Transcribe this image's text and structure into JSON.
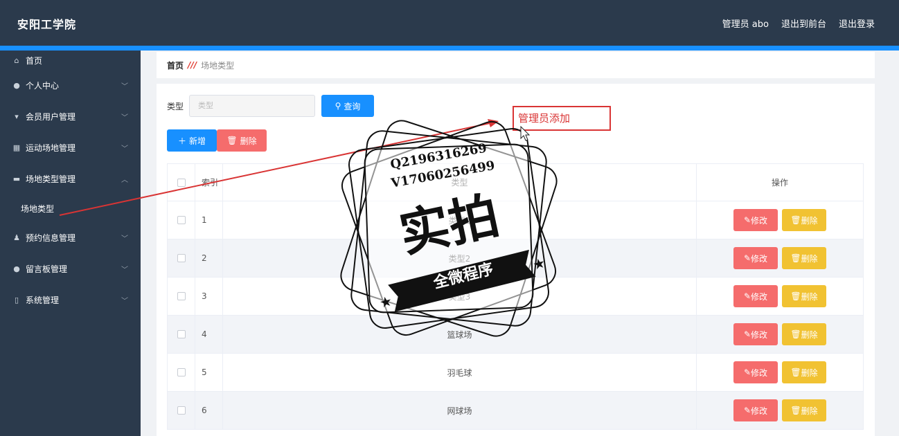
{
  "header": {
    "title": "安阳工学院",
    "admin_label": "管理员 abo",
    "front_label": "退出到前台",
    "logout_label": "退出登录"
  },
  "sidebar": {
    "items": [
      {
        "label": "首页",
        "icon": "home-icon"
      },
      {
        "label": "个人中心",
        "icon": "user-icon"
      },
      {
        "label": "会员用户管理",
        "icon": "member-icon"
      },
      {
        "label": "运动场地管理",
        "icon": "grid-icon"
      },
      {
        "label": "场地类型管理",
        "icon": "category-icon"
      },
      {
        "label": "预约信息管理",
        "icon": "reserve-icon"
      },
      {
        "label": "留言板管理",
        "icon": "message-icon"
      },
      {
        "label": "系统管理",
        "icon": "system-icon"
      }
    ],
    "sub_item": "场地类型"
  },
  "breadcrumb": {
    "home": "首页",
    "current": "场地类型"
  },
  "search": {
    "label": "类型",
    "placeholder": "类型",
    "query_label": "查询"
  },
  "actions": {
    "add_label": "新增",
    "delete_label": "删除"
  },
  "table": {
    "headers": [
      "索引",
      "类型",
      "操作"
    ],
    "rows": [
      {
        "index": "1",
        "type": "类型1"
      },
      {
        "index": "2",
        "type": "类型2"
      },
      {
        "index": "3",
        "type": "类型3"
      },
      {
        "index": "4",
        "type": "篮球场"
      },
      {
        "index": "5",
        "type": "羽毛球"
      },
      {
        "index": "6",
        "type": "网球场"
      }
    ],
    "edit_label": "修改",
    "delete_label": "删除"
  },
  "annotation": {
    "text": "管理员添加"
  },
  "watermark": {
    "line1": "Q2196316269",
    "line2": "V17060256499",
    "main": "实拍",
    "banner": "全微程序"
  },
  "colors": {
    "header_bg": "#2b3a4c",
    "accent": "#1890ff",
    "danger": "#f56c6c",
    "warning": "#f1c232",
    "annotation": "#d93434"
  }
}
